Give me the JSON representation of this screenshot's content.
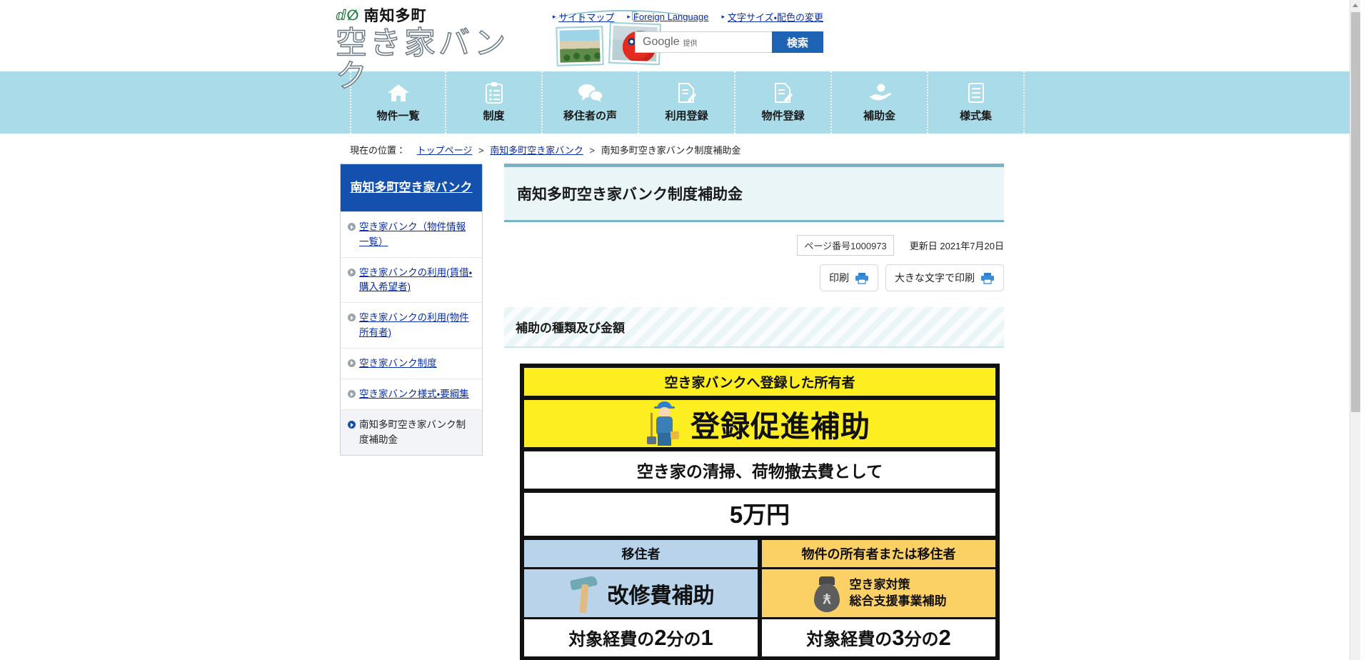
{
  "header": {
    "town_name": "南知多町",
    "site_title": "空き家バンク",
    "logo_mark": "leaf-mark",
    "top_links": [
      {
        "label": "サイトマップ",
        "name": "sitemap-link"
      },
      {
        "label": "Foreign Language",
        "name": "foreign-language-link"
      },
      {
        "label": "文字サイズ・配色の変更",
        "name": "text-size-color-link"
      }
    ],
    "search": {
      "placeholder": "Google",
      "provider_note": "提供",
      "button_label": "検索"
    }
  },
  "gnav": [
    {
      "label": "物件一覧",
      "icon": "home-icon"
    },
    {
      "label": "制度",
      "icon": "clipboard-list-icon"
    },
    {
      "label": "移住者の声",
      "icon": "speech-bubbles-icon"
    },
    {
      "label": "利用登録",
      "icon": "document-pencil-icon"
    },
    {
      "label": "物件登録",
      "icon": "document-pencil-icon"
    },
    {
      "label": "補助金",
      "icon": "hand-coin-icon"
    },
    {
      "label": "様式集",
      "icon": "document-lines-icon"
    }
  ],
  "breadcrumb": {
    "lead": "現在の位置：",
    "items": [
      {
        "label": "トップページ",
        "link": true
      },
      {
        "label": "南知多町空き家バンク",
        "link": true
      },
      {
        "label": "南知多町空き家バンク制度補助金",
        "link": false
      }
    ],
    "separator": "＞"
  },
  "sidebar": {
    "heading": "南知多町空き家バンク",
    "items": [
      {
        "label": "空き家バンク（物件情報一覧）",
        "current": false
      },
      {
        "label": "空き家バンクの利用(賃借・購入希望者)",
        "current": false
      },
      {
        "label": "空き家バンクの利用(物件所有者)",
        "current": false
      },
      {
        "label": "空き家バンク制度",
        "current": false
      },
      {
        "label": "空き家バンク様式・要綱集",
        "current": false
      },
      {
        "label": "南知多町空き家バンク制度補助金",
        "current": true
      }
    ]
  },
  "main": {
    "page_title": "南知多町空き家バンク制度補助金",
    "page_number_label": "ページ番号1000973",
    "updated_label": "更新日 2021年7月20日",
    "print_button": "印刷",
    "print_large_button": "大きな文字で印刷",
    "section_heading": "補助の種類及び金額",
    "infographic": {
      "top": {
        "target": "空き家バンクへ登録した所有者",
        "title": "登録促進補助",
        "icon": "cleaning-worker-icon",
        "description": "空き家の清掃、荷物撤去費として",
        "amount": "5万円"
      },
      "columns": [
        {
          "target": "移住者",
          "title": "改修費補助",
          "icon": "hammer-icon",
          "rate_prefix": "対象経費の",
          "rate_denom": "2",
          "rate_mid": "分の",
          "rate_num": "1",
          "accent": "#b8d3ea"
        },
        {
          "target": "物件の所有者または移住者",
          "title_line1": "空き家対策",
          "title_line2": "総合支援事業補助",
          "icon": "money-bag-icon",
          "rate_prefix": "対象経費の",
          "rate_denom": "3",
          "rate_mid": "分の",
          "rate_num": "2",
          "accent": "#fbd166"
        }
      ]
    }
  },
  "colors": {
    "nav_bg": "#a9dbe8",
    "sidebar_head": "#1450ad",
    "link": "#0b2fa8",
    "title_bg": "#eaf5f8",
    "title_border": "#7ab4c4",
    "highlight_yellow": "#fcee21",
    "search_button": "#1f63b5"
  }
}
